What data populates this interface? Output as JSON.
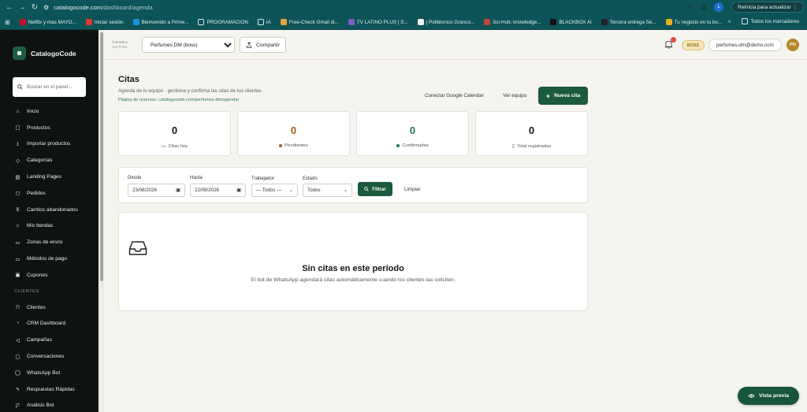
{
  "browser": {
    "url_host": "catalogocode.com",
    "url_path": "/dashboard/agenda",
    "profile_initial": "L",
    "update_label": "Reinicia para actualizar",
    "bookmarks": [
      {
        "label": "Netflix y mas MAYO...",
        "color": "#c8102e"
      },
      {
        "label": "Iniciar sesión",
        "color": "#e03a2f"
      },
      {
        "label": "Bienvenido a Prime...",
        "color": "#1a8fe3"
      },
      {
        "label": "PROGRAMACION",
        "color": "folder"
      },
      {
        "label": "IA",
        "color": "folder"
      },
      {
        "label": "Free-Check Gmail di...",
        "color": "#e8a33c"
      },
      {
        "label": "TV LATINO PLUS | S...",
        "color": "#7a5ec9"
      },
      {
        "label": "| Politécnico Granco...",
        "color": "#f2f2f2"
      },
      {
        "label": "Sci-Hub: knowledge...",
        "color": "#b44"
      },
      {
        "label": "BLACKBOX AI",
        "color": "#111"
      },
      {
        "label": "Tercera entrega Se...",
        "color": "#222"
      },
      {
        "label": "Tu negocio en tu bo...",
        "color": "#e7b31e"
      }
    ],
    "bookmarks_more": "»",
    "all_bookmarks": "Todos los marcadores"
  },
  "sidebar": {
    "brand": "CatalogoCode",
    "search_placeholder": "Buscar en el panel...",
    "items": [
      {
        "label": "Inicio",
        "icon": "home-icon"
      },
      {
        "label": "Productos",
        "icon": "box-icon"
      },
      {
        "label": "Importar productos",
        "icon": "import-icon"
      },
      {
        "label": "Categorías",
        "icon": "tag-icon"
      },
      {
        "label": "Landing Pages",
        "icon": "layout-icon"
      },
      {
        "label": "Pedidos",
        "icon": "bag-icon"
      },
      {
        "label": "Carritos abandonados",
        "icon": "cart-icon"
      },
      {
        "label": "Mis tiendas",
        "icon": "store-icon"
      },
      {
        "label": "Zonas de envío",
        "icon": "truck-icon"
      },
      {
        "label": "Métodos de pago",
        "icon": "card-icon"
      },
      {
        "label": "Cupones",
        "icon": "ticket-icon"
      }
    ],
    "section_label": "CLIENTES",
    "client_items": [
      {
        "label": "Clientes",
        "icon": "users-icon"
      },
      {
        "label": "CRM Dashboard",
        "icon": "crm-icon"
      },
      {
        "label": "Campañas",
        "icon": "megaphone-icon"
      },
      {
        "label": "Conversaciones",
        "icon": "chat-icon"
      },
      {
        "label": "WhatsApp Bot",
        "icon": "whatsapp-icon"
      },
      {
        "label": "Respuestas Rápidas",
        "icon": "bolt-icon"
      },
      {
        "label": "Análisis Bot",
        "icon": "chart-icon"
      }
    ]
  },
  "topbar": {
    "store_label_1": "TIENDA",
    "store_label_2": "ACTIVA",
    "store_selected": "Perfumes DM (boss)",
    "share_label": "Compartir",
    "badge": "BOSS",
    "email": "perfumes-dm@demo.com",
    "avatar": "PD"
  },
  "page": {
    "title": "Citas",
    "subtitle": "Agenda de tu equipo · gestiona y confirma las citas de tus clientes",
    "booking_link": "Página de reservas: catalogocode.com/perfumes-dm/agendar",
    "connect_calendar": "Conectar Google Calendar",
    "view_team": "Ver equipo",
    "new_button": "Nueva cita"
  },
  "stats": [
    {
      "value": "0",
      "label": "Citas hoy",
      "color": "#141814",
      "marker": "calendar"
    },
    {
      "value": "0",
      "label": "Pendientes",
      "color": "#a0611b",
      "marker": "#a0611b"
    },
    {
      "value": "0",
      "label": "Confirmadas",
      "color": "#1f7a4a",
      "marker": "#1f7a4a"
    },
    {
      "value": "0",
      "label": "Total registradas",
      "color": "#141814",
      "marker": "clipboard"
    }
  ],
  "filters": {
    "from_label": "Desde",
    "from_value": "23/08/2026",
    "to_label": "Hasta",
    "to_value": "22/09/2026",
    "worker_label": "Trabajador",
    "worker_value": "— Todos —",
    "status_label": "Estado",
    "status_value": "Todos",
    "filter_button": "Filtrar",
    "clear_button": "Limpiar"
  },
  "empty": {
    "title": "Sin citas en este período",
    "subtitle": "El bot de WhatsApp agendará citas automáticamente cuando los clientes las soliciten."
  },
  "preview_button": "Vista previa"
}
